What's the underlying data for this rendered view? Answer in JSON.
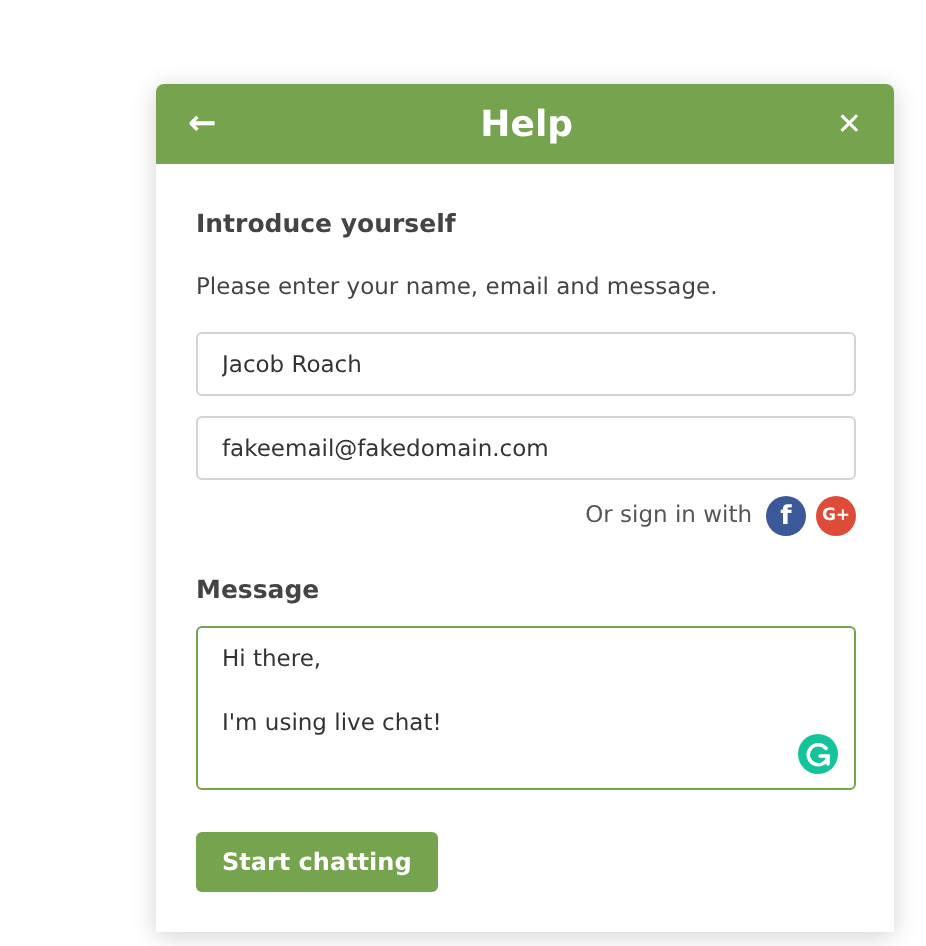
{
  "header": {
    "back_glyph": "←",
    "title": "Help",
    "close_glyph": "✕"
  },
  "intro": {
    "heading": "Introduce yourself",
    "text": "Please enter your name, email and message."
  },
  "fields": [
    {
      "value": "Jacob Roach"
    },
    {
      "value": "fakeemail@fakedomain.com"
    }
  ],
  "sign_in": {
    "label": "Or sign in with",
    "providers": [
      {
        "kind": "facebook",
        "glyph": "f",
        "color": "#3b5998"
      },
      {
        "kind": "google",
        "glyph": "G+",
        "color": "#dd4b39"
      }
    ]
  },
  "message": {
    "label": "Message",
    "value": "Hi there,\n\nI'm using live chat!",
    "focused": true
  },
  "submit": "Start chatting"
}
